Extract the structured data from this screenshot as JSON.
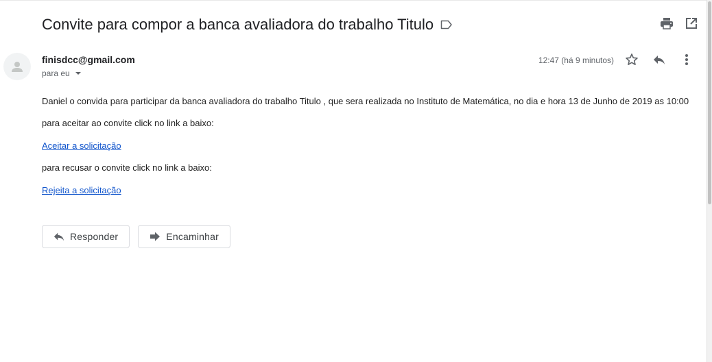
{
  "email": {
    "subject": "Convite para compor a banca avaliadora do trabalho Titulo",
    "sender": "finisdcc@gmail.com",
    "to_label": "para eu",
    "time": "12:47 (há 9 minutos)",
    "body": {
      "line1": "Daniel o convida para participar da banca avaliadora do trabalho Titulo , que sera realizada no Instituto de Matemática, no dia e hora 13 de Junho de 2019 as 10:00",
      "line2": "para aceitar ao convite click no link a baixo:",
      "accept_link": "Aceitar a solicitação",
      "line3": "para recusar o convite click no link a baixo:",
      "reject_link": "Rejeita a solicitação"
    }
  },
  "actions": {
    "reply_label": "Responder",
    "forward_label": "Encaminhar"
  },
  "icons": {
    "label": "label-icon",
    "print": "print-icon",
    "open_new_window": "open-in-new-icon",
    "avatar": "person-icon",
    "star": "star-icon",
    "reply": "reply-icon",
    "more": "more-vert-icon",
    "forward": "forward-icon"
  },
  "colors": {
    "link": "#1155cc",
    "icon": "#5f6368",
    "border": "#dadce0"
  }
}
